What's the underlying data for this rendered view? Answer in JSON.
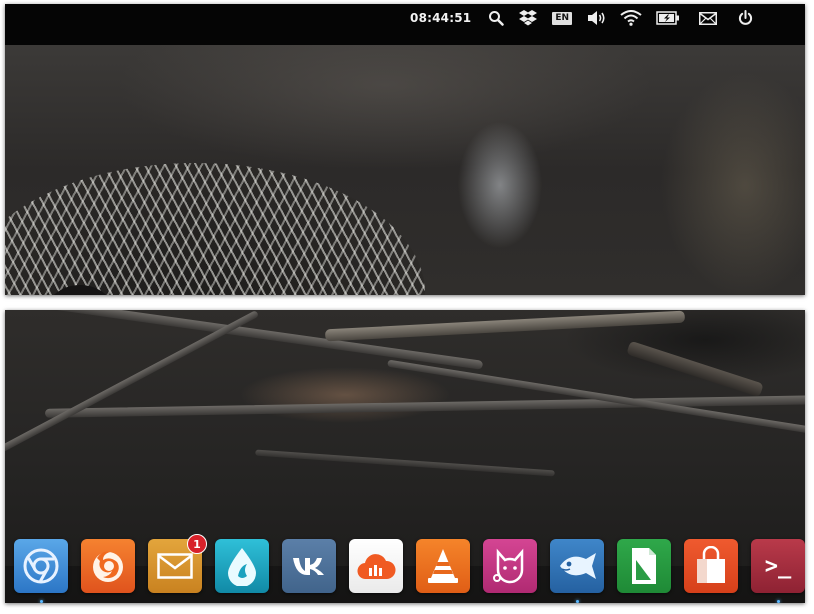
{
  "panel": {
    "clock": "08:44:51",
    "language": "EN",
    "tray_icons": [
      "search-icon",
      "dropbox-icon",
      "keyboard-layout-icon",
      "volume-icon",
      "wifi-icon",
      "battery-icon",
      "mail-icon",
      "power-icon"
    ]
  },
  "dock": {
    "apps": [
      {
        "name": "chromium",
        "icon": "chromium-icon",
        "running": true
      },
      {
        "name": "firefox",
        "icon": "firefox-icon",
        "running": false
      },
      {
        "name": "mail",
        "icon": "mail-app-icon",
        "running": false,
        "badge": "1"
      },
      {
        "name": "water-drop",
        "icon": "water-drop-icon",
        "running": false
      },
      {
        "name": "vk",
        "icon": "vk-icon",
        "running": false
      },
      {
        "name": "cloud-music",
        "icon": "cloud-music-icon",
        "running": false
      },
      {
        "name": "vlc",
        "icon": "vlc-icon",
        "running": false
      },
      {
        "name": "cat-app",
        "icon": "cat-app-icon",
        "running": false
      },
      {
        "name": "fish-app",
        "icon": "fish-app-icon",
        "running": true
      },
      {
        "name": "libreoffice",
        "icon": "libreoffice-icon",
        "running": false
      },
      {
        "name": "software-center",
        "icon": "shopping-bag-icon",
        "running": false
      },
      {
        "name": "terminal",
        "icon": "terminal-icon",
        "running": true,
        "glyph": ">_"
      }
    ]
  },
  "colors": {
    "panel_bg": "#050505",
    "badge_red": "#d8212a",
    "running_indicator": "#5ab8ff"
  }
}
